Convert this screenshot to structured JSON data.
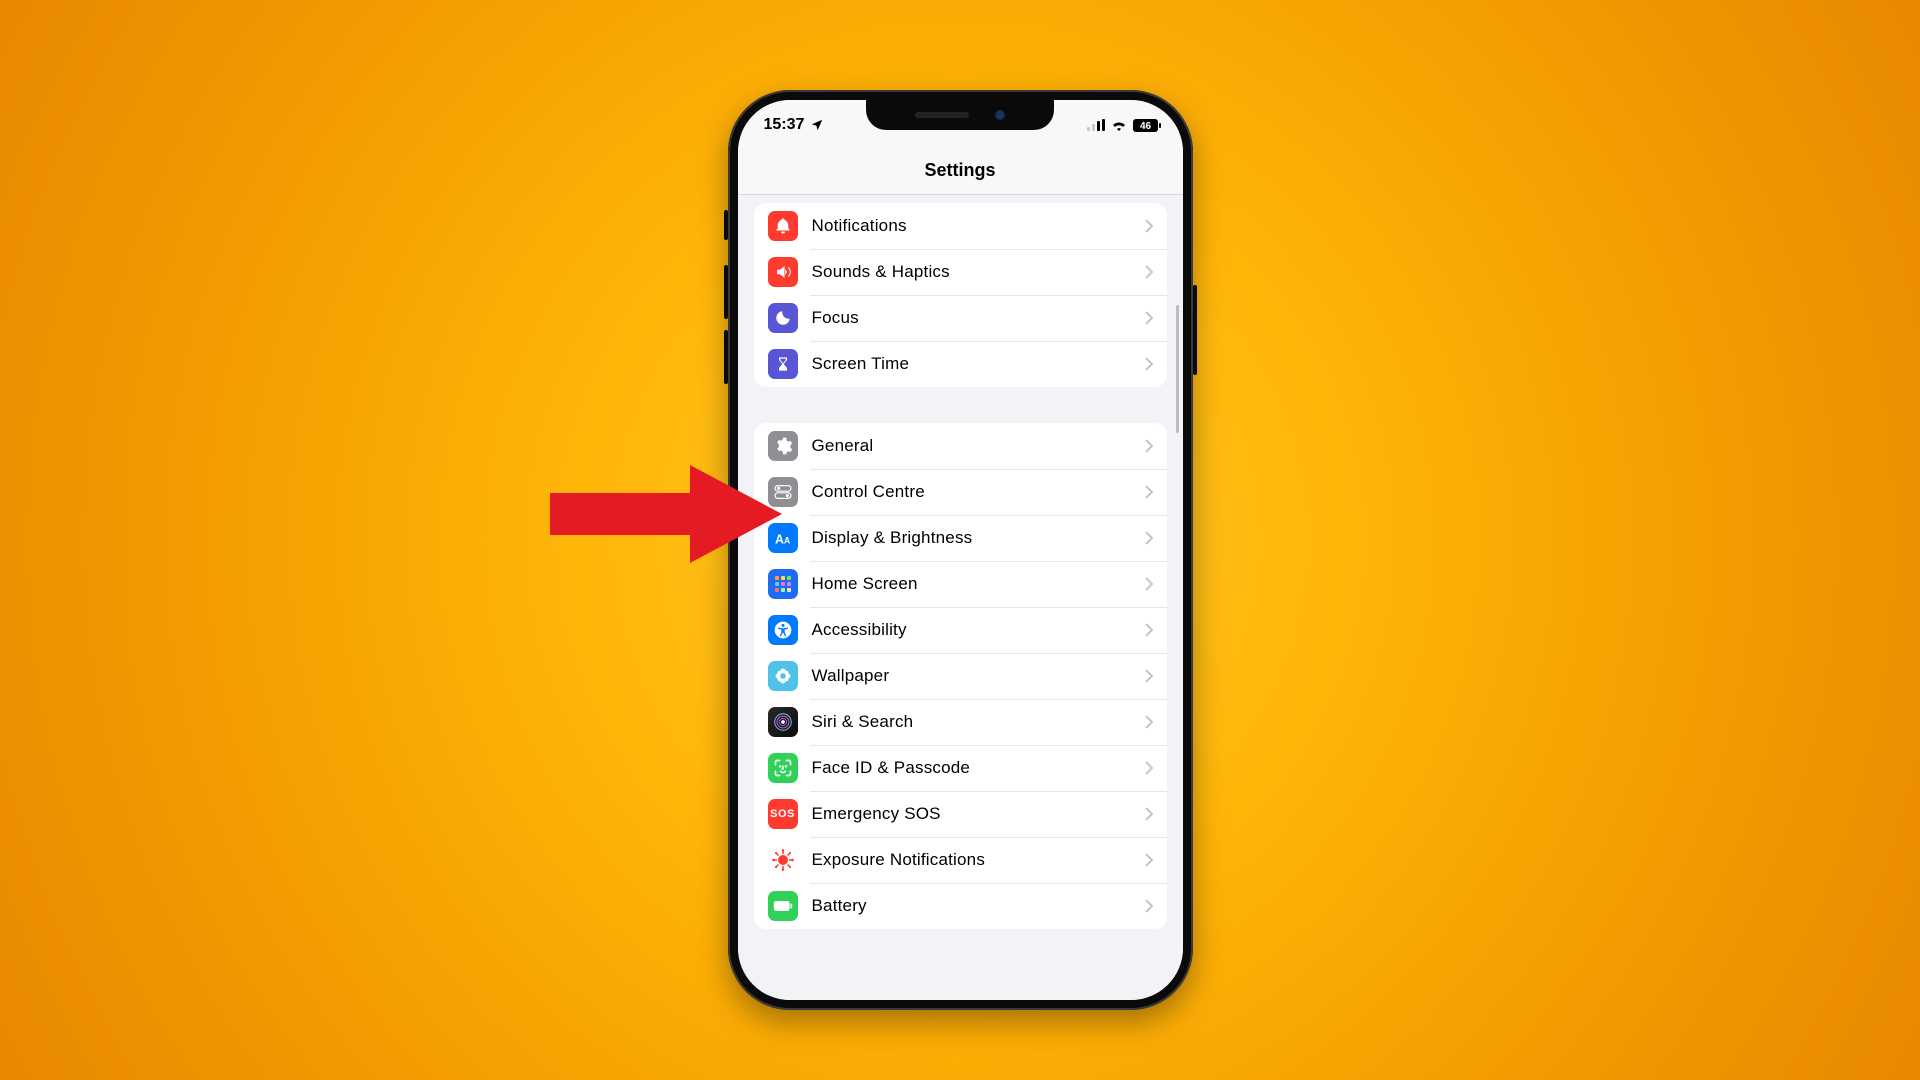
{
  "status": {
    "time": "15:37",
    "battery": "46"
  },
  "nav": {
    "title": "Settings"
  },
  "groups": [
    {
      "id": "g1",
      "items": [
        {
          "id": "notifications",
          "label": "Notifications",
          "icon": "bell-icon",
          "bg": "bg-red"
        },
        {
          "id": "sounds-haptics",
          "label": "Sounds & Haptics",
          "icon": "speaker-icon",
          "bg": "bg-red2"
        },
        {
          "id": "focus",
          "label": "Focus",
          "icon": "moon-icon",
          "bg": "bg-indigo"
        },
        {
          "id": "screen-time",
          "label": "Screen Time",
          "icon": "hourglass-icon",
          "bg": "bg-indigo2"
        }
      ]
    },
    {
      "id": "g2",
      "items": [
        {
          "id": "general",
          "label": "General",
          "icon": "gear-icon",
          "bg": "bg-gray"
        },
        {
          "id": "control-centre",
          "label": "Control Centre",
          "icon": "toggles-icon",
          "bg": "bg-gray2"
        },
        {
          "id": "display-brightness",
          "label": "Display & Brightness",
          "icon": "text-size-icon",
          "bg": "bg-blue"
        },
        {
          "id": "home-screen",
          "label": "Home Screen",
          "icon": "grid-icon",
          "bg": "bg-blue2"
        },
        {
          "id": "accessibility",
          "label": "Accessibility",
          "icon": "accessibility-icon",
          "bg": "bg-blue3"
        },
        {
          "id": "wallpaper",
          "label": "Wallpaper",
          "icon": "flower-icon",
          "bg": "bg-cyan"
        },
        {
          "id": "siri-search",
          "label": "Siri & Search",
          "icon": "siri-icon",
          "bg": "bg-siri"
        },
        {
          "id": "face-id-passcode",
          "label": "Face ID & Passcode",
          "icon": "faceid-icon",
          "bg": "bg-green"
        },
        {
          "id": "emergency-sos",
          "label": "Emergency SOS",
          "icon": "sos-icon",
          "bg": "bg-red3"
        },
        {
          "id": "exposure-notifications",
          "label": "Exposure Notifications",
          "icon": "exposure-icon",
          "bg": "bg-exposure"
        },
        {
          "id": "battery",
          "label": "Battery",
          "icon": "battery-icon",
          "bg": "bg-green2"
        }
      ]
    }
  ],
  "annotation": {
    "points_to": "control-centre"
  }
}
